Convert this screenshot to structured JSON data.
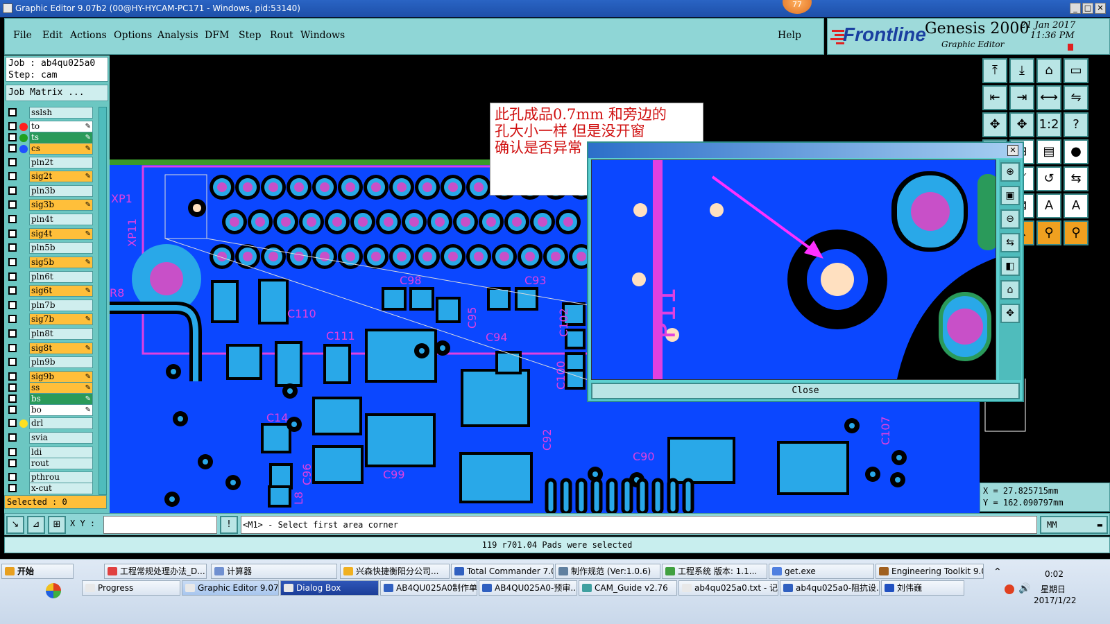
{
  "window": {
    "title": "Graphic Editor 9.07b2 (00@HY-HYCAM-PC171 - Windows, pid:53140)",
    "badge": "77"
  },
  "menu": {
    "items": [
      "File",
      "Edit",
      "Actions",
      "Options",
      "Analysis",
      "DFM",
      "Step",
      "Rout",
      "Windows"
    ],
    "help": "Help"
  },
  "brand": {
    "logo": "Frontline",
    "product": "Genesis 2000",
    "subtitle": "Graphic Editor",
    "date": "21 Jan 2017",
    "time": "11:36 PM"
  },
  "job": {
    "job_label": "Job : ab4qu025a0",
    "step_label": "Step: cam",
    "matrix_button": "Job Matrix ..."
  },
  "layers": [
    {
      "name": "sslsh",
      "style": "plain",
      "dot": ""
    },
    {
      "name": "to",
      "style": "white",
      "dot": "#ff2020",
      "edit": true
    },
    {
      "name": "ts",
      "style": "green",
      "dot": "#20a020",
      "edit": true
    },
    {
      "name": "cs",
      "style": "orange",
      "dot": "#2050ff",
      "edit": true
    },
    {
      "name": "pln2t",
      "style": "plain",
      "dot": ""
    },
    {
      "name": "sig2t",
      "style": "orange",
      "dot": "",
      "edit": true
    },
    {
      "name": "pln3b",
      "style": "plain",
      "dot": ""
    },
    {
      "name": "sig3b",
      "style": "orange",
      "dot": "",
      "edit": true
    },
    {
      "name": "pln4t",
      "style": "plain",
      "dot": ""
    },
    {
      "name": "sig4t",
      "style": "orange",
      "dot": "",
      "edit": true
    },
    {
      "name": "pln5b",
      "style": "plain",
      "dot": ""
    },
    {
      "name": "sig5b",
      "style": "orange",
      "dot": "",
      "edit": true
    },
    {
      "name": "pln6t",
      "style": "plain",
      "dot": ""
    },
    {
      "name": "sig6t",
      "style": "orange",
      "dot": "",
      "edit": true
    },
    {
      "name": "pln7b",
      "style": "plain",
      "dot": ""
    },
    {
      "name": "sig7b",
      "style": "orange",
      "dot": "",
      "edit": true
    },
    {
      "name": "pln8t",
      "style": "plain",
      "dot": ""
    },
    {
      "name": "sig8t",
      "style": "orange",
      "dot": "",
      "edit": true
    },
    {
      "name": "pln9b",
      "style": "plain",
      "dot": ""
    },
    {
      "name": "sig9b",
      "style": "orange",
      "dot": "",
      "edit": true
    },
    {
      "name": "ss",
      "style": "orange",
      "dot": "",
      "edit": true
    },
    {
      "name": "bs",
      "style": "green",
      "dot": "",
      "edit": true
    },
    {
      "name": "bo",
      "style": "white",
      "dot": "",
      "edit": true
    },
    {
      "name": "drl",
      "style": "plain",
      "dot": "#ffe020"
    },
    {
      "name": "svia",
      "style": "plain",
      "dot": ""
    },
    {
      "name": "ldi",
      "style": "plain",
      "dot": ""
    },
    {
      "name": "rout",
      "style": "plain",
      "dot": ""
    },
    {
      "name": "pthrou",
      "style": "plain",
      "dot": ""
    },
    {
      "name": "x-cut",
      "style": "plain",
      "dot": ""
    }
  ],
  "selected_label": "Selected : 0",
  "note": {
    "line1": "此孔成品0.7mm  和旁边的",
    "line2": "孔大小一样  但是没开窗",
    "line3": "确认是否异常"
  },
  "dialog": {
    "close_label": "Close"
  },
  "board_labels": [
    "XP1",
    "XP11",
    "R8",
    "C110",
    "C98",
    "C93",
    "C95",
    "C111",
    "C94",
    "C102",
    "C100",
    "C14",
    "C96",
    "C99",
    "L8",
    "C92",
    "C90",
    "C107"
  ],
  "coords": {
    "x": "X = 27.825715mm",
    "y": "Y = 162.090797mm"
  },
  "cmd": {
    "xy_label": "X Y :",
    "xy_value": "",
    "prompt": "<M1> - Select first area corner",
    "units": "MM"
  },
  "status": "119 r701.04 Pads were selected",
  "taskbar": {
    "start": "开始",
    "row1": [
      "工程常规处理办法_D...",
      "计算器",
      "兴森快捷衡阳分公司...",
      "Total Commander 7.0 p...",
      "制作规范 (Ver:1.0.6)",
      "工程系统  版本: 1.1...",
      "get.exe",
      "Engineering Toolkit 9.0..."
    ],
    "row2": [
      "Progress",
      "Graphic Editor 9.07...",
      "Dialog Box",
      "AB4QU025A0制作单...",
      "AB4QU025A0-预审...",
      "CAM_Guide v2.76",
      "ab4qu025a0.txt - 记...",
      "ab4qu025a0-阻抗设...",
      "刘伟巍"
    ],
    "clock_time": "0:02",
    "clock_day": "星期日",
    "clock_date": "2017/1/22"
  }
}
